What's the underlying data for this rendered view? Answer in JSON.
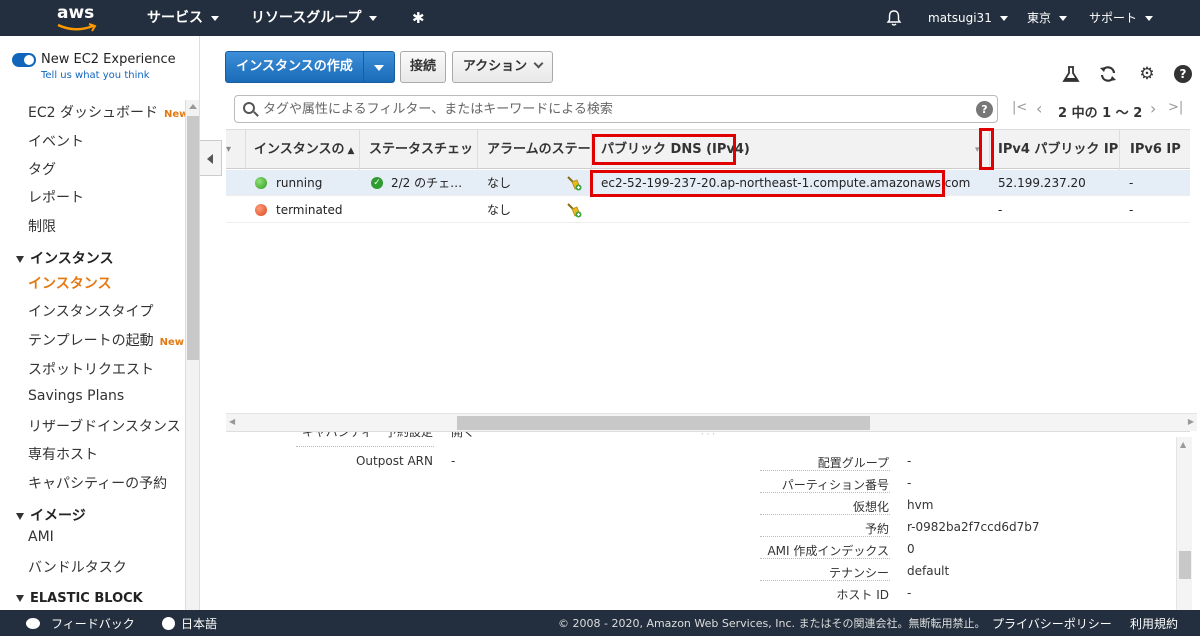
{
  "topnav": {
    "logo_text": "aws",
    "services_label": "サービス",
    "resource_groups_label": "リソースグループ",
    "user_label": "matsugi31",
    "region_label": "東京",
    "support_label": "サポート"
  },
  "sidebar": {
    "experience_label": "New EC2 Experience",
    "experience_link": "Tell us what you think",
    "items": [
      {
        "label": "EC2 ダッシュボード",
        "badge": "New"
      },
      {
        "label": "イベント",
        "badge": ""
      },
      {
        "label": "タグ",
        "badge": ""
      },
      {
        "label": "レポート",
        "badge": ""
      },
      {
        "label": "制限",
        "badge": ""
      }
    ],
    "section_instances": "インスタンス",
    "instance_items": [
      {
        "label": "インスタンス",
        "badge": ""
      },
      {
        "label": "インスタンスタイプ",
        "badge": ""
      },
      {
        "label": "テンプレートの起動",
        "badge": "New"
      },
      {
        "label": "スポットリクエスト",
        "badge": ""
      },
      {
        "label": "Savings Plans",
        "badge": ""
      },
      {
        "label": "リザーブドインスタンス",
        "badge": ""
      },
      {
        "label": "専有ホスト",
        "badge": ""
      },
      {
        "label": "キャパシティーの予約",
        "badge": ""
      }
    ],
    "section_images": "イメージ",
    "image_items": [
      {
        "label": "AMI"
      },
      {
        "label": "バンドルタスク"
      }
    ],
    "section_ebs": "ELASTIC BLOCK"
  },
  "toolbar": {
    "launch_label": "インスタンスの作成",
    "connect_label": "接続",
    "actions_label": "アクション"
  },
  "search": {
    "placeholder": "タグや属性によるフィルター、またはキーワードによる検索",
    "pager_text": "2 中の 1 ～ 2"
  },
  "table": {
    "columns": {
      "name": "インスタンスの",
      "status": "ステータスチェッ",
      "alarm": "アラームのステー",
      "dns": "パブリック DNS (IPv4)",
      "ipv4": "IPv4 パブリック IP",
      "ipv6": "IPv6 IP"
    },
    "rows": [
      {
        "state": "running",
        "status": "2/2 のチェ…",
        "alarm": "なし",
        "dns": "ec2-52-199-237-20.ap-northeast-1.compute.amazonaws.com",
        "ipv4": "52.199.237.20",
        "ipv6": "-"
      },
      {
        "state": "terminated",
        "status": "",
        "alarm": "なし",
        "dns": "",
        "ipv4": "-",
        "ipv6": "-"
      }
    ]
  },
  "details": {
    "left": [
      {
        "label": "キャパシティー予約設定",
        "value": "開く"
      },
      {
        "label": "Outpost ARN",
        "value": "-"
      }
    ],
    "right": [
      {
        "label": "配置グループ",
        "value": "-"
      },
      {
        "label": "パーティション番号",
        "value": "-"
      },
      {
        "label": "仮想化",
        "value": "hvm"
      },
      {
        "label": "予約",
        "value": "r-0982ba2f7ccd6d7b7"
      },
      {
        "label": "AMI 作成インデックス",
        "value": "0"
      },
      {
        "label": "テナンシー",
        "value": "default"
      },
      {
        "label": "ホスト ID",
        "value": "-"
      }
    ]
  },
  "footer": {
    "feedback_label": "フィードバック",
    "language_label": "日本語",
    "copyright": "© 2008 - 2020, Amazon Web Services, Inc. またはその関連会社。無断転用禁止。",
    "privacy_label": "プライバシーポリシー",
    "terms_label": "利用規約"
  },
  "colors": {
    "nav_bg": "#232f3e",
    "primary_button": "#1a6bb8",
    "accent_orange": "#e47911",
    "highlight_red": "#e00000"
  }
}
